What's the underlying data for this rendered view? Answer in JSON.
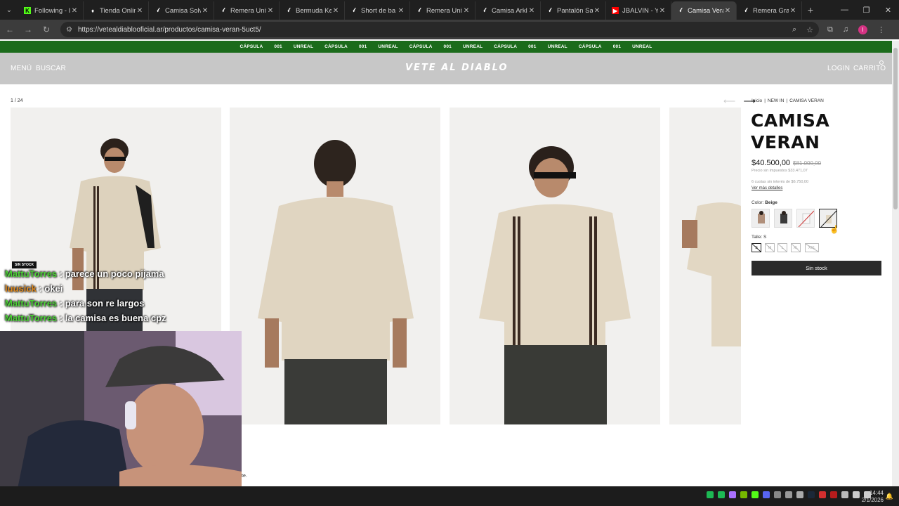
{
  "browser": {
    "tabs": [
      {
        "title": "Following - I",
        "icon": "kick-icon",
        "color": "#53fc18",
        "active": false
      },
      {
        "title": "Tienda Onlin",
        "icon": "tiendanube-icon",
        "color": "#ffffff",
        "active": false
      },
      {
        "title": "Camisa Solv",
        "icon": "site-icon",
        "color": "#ffffff",
        "active": false
      },
      {
        "title": "Remera Univ",
        "icon": "site-icon",
        "color": "#ffffff",
        "active": false
      },
      {
        "title": "Bermuda Ke",
        "icon": "site-icon",
        "color": "#ffffff",
        "active": false
      },
      {
        "title": "Short de ba",
        "icon": "site-icon",
        "color": "#ffffff",
        "active": false
      },
      {
        "title": "Remera Univ",
        "icon": "site-icon",
        "color": "#ffffff",
        "active": false
      },
      {
        "title": "Camisa Arkl",
        "icon": "site-icon",
        "color": "#ffffff",
        "active": false
      },
      {
        "title": "Pantalón Sa",
        "icon": "site-icon",
        "color": "#ffffff",
        "active": false
      },
      {
        "title": "JBALVIN - Yo",
        "icon": "youtube-icon",
        "color": "#ff0000",
        "active": false
      },
      {
        "title": "Camisa Vera",
        "icon": "site-icon",
        "color": "#ffffff",
        "active": true
      },
      {
        "title": "Remera Grai",
        "icon": "site-icon",
        "color": "#ffffff",
        "active": false
      }
    ],
    "url": "https://vetealdiablooficial.ar/productos/camisa-veran-5uct5/",
    "profile_initial": "I"
  },
  "announcement": [
    "CÁPSULA",
    "001",
    "UNREAL",
    "CÁPSULA",
    "001",
    "UNREAL",
    "CÁPSULA",
    "001",
    "UNREAL",
    "CÁPSULA",
    "001",
    "UNREAL",
    "CÁPSULA",
    "001",
    "UNREAL"
  ],
  "site_header": {
    "menu": "MENÚ",
    "search": "BUSCAR",
    "logo": "VETE AL DIABLO",
    "login": "LOGIN",
    "cart": "CARRITO"
  },
  "gallery": {
    "counter": "1 / 24",
    "prev_arrow": "⟵",
    "next_arrow": "⟶"
  },
  "product": {
    "breadcrumb": [
      "Inicio",
      "|",
      "NEW IN",
      "|",
      "CAMISA VERAN"
    ],
    "title_line1": "CAMISA",
    "title_line2": "VERAN",
    "price": "$40.500,00",
    "old_price": "$81.000,00",
    "tax_note": "Precio sin impuestos $33.471,07",
    "installments": "6 cuotas sin interés de $6.750,00",
    "details_link": "Ver más detalles",
    "color_label": "Color:",
    "color_value": "Beige",
    "size_label": "Talle:",
    "size_value": "S",
    "sizes": [
      "S",
      "M",
      "L",
      "XL",
      "XXL"
    ],
    "button": "Sin stock"
  },
  "overlay": {
    "badge": "SIN STOCK",
    "chat": [
      {
        "user": "MattuTorres",
        "color": "#4cd137",
        "text": ": parece un poco pijama"
      },
      {
        "user": "luusick",
        "color": "#e08a1e",
        "text": ": okei"
      },
      {
        "user": "MattuTorres",
        "color": "#4cd137",
        "text": ": para son re largos"
      },
      {
        "user": "MattuTorres",
        "color": "#4cd137",
        "text": ": la camisa es buena cpz"
      }
    ],
    "stray_text": "te."
  },
  "taskbar": {
    "time": "14:44",
    "date": "2/1/2026"
  }
}
